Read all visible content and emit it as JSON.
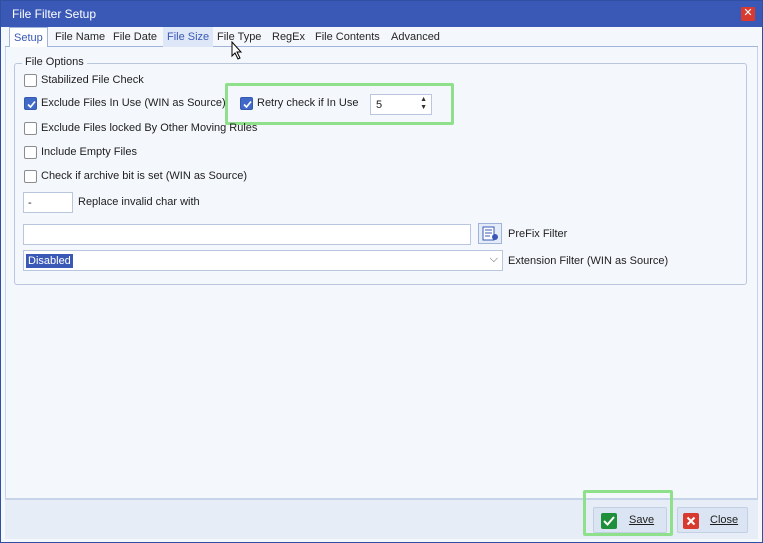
{
  "window": {
    "title": "File Filter Setup",
    "close_glyph": "✕"
  },
  "tabs": [
    "Setup",
    "File Name",
    "File Date",
    "File Size",
    "File Type",
    "RegEx",
    "File Contents",
    "Advanced"
  ],
  "group": {
    "title": "File Options",
    "stabilized": {
      "label": "Stabilized File Check",
      "checked": false
    },
    "exclude_in_use": {
      "label": "Exclude Files In Use (WIN as Source)",
      "checked": true
    },
    "retry": {
      "label": "Retry check if In Use",
      "checked": true,
      "value": "5"
    },
    "exclude_locked": {
      "label": "Exclude Files locked By Other Moving Rules",
      "checked": false
    },
    "include_empty": {
      "label": "Include Empty Files",
      "checked": false
    },
    "archive_bit": {
      "label": "Check if archive bit is set (WIN as Source)",
      "checked": false
    },
    "replace_char": {
      "value": "-",
      "label": "Replace invalid char with"
    },
    "prefix": {
      "value": "",
      "label": "PreFix Filter"
    },
    "extension": {
      "value": "Disabled",
      "label": "Extension Filter (WIN as Source)"
    }
  },
  "buttons": {
    "save": "Save",
    "close": "Close"
  },
  "colors": {
    "accent": "#3a59b7",
    "highlight": "#8ee08a",
    "check": "#4169c8",
    "close_red": "#d93a2f",
    "save_green": "#1f8f3a"
  }
}
